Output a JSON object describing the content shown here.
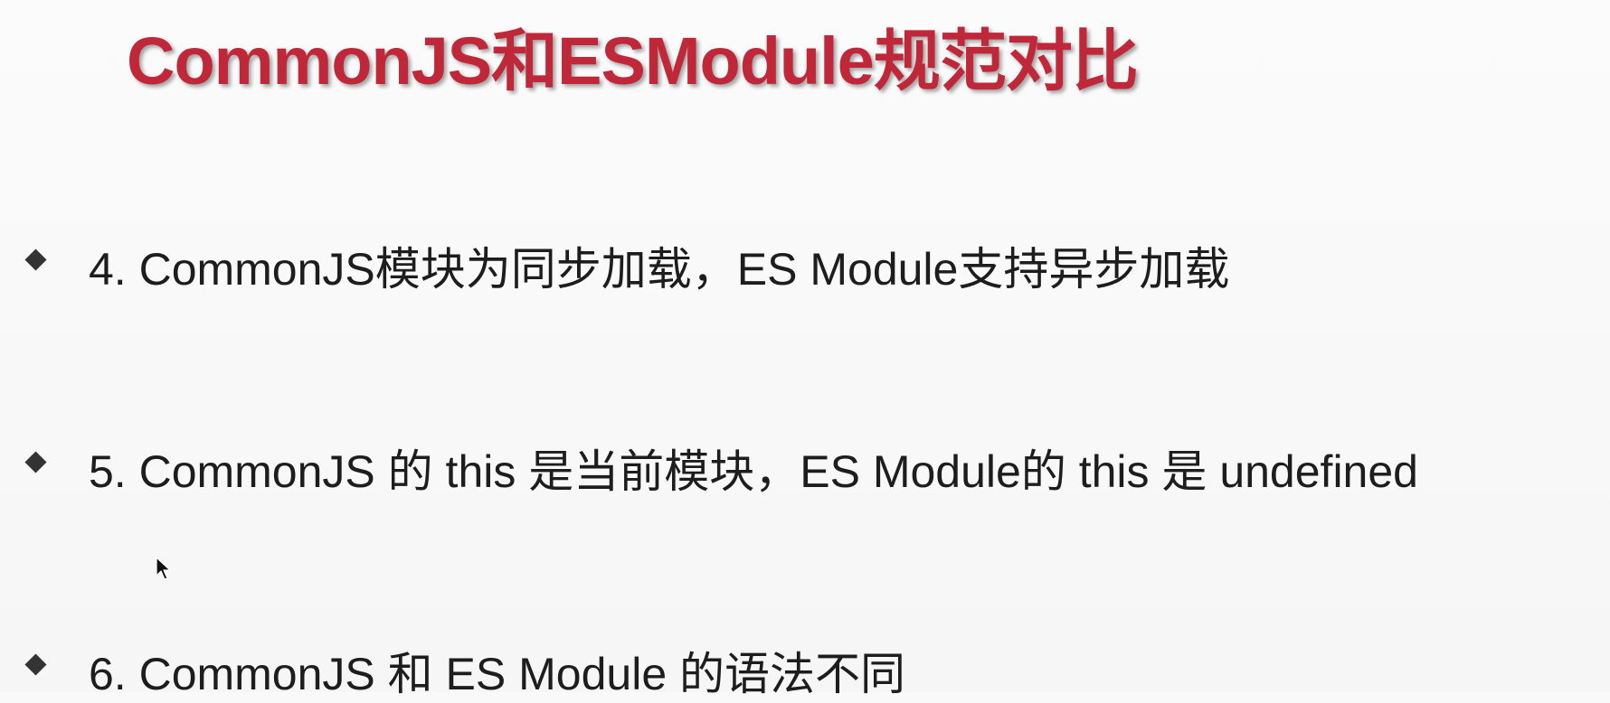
{
  "slide": {
    "title": "CommonJS和ESModule规范对比",
    "bullets": [
      "4. CommonJS模块为同步加载，ES Module支持异步加载",
      "5. CommonJS 的 this 是当前模块，ES Module的 this 是 undefined",
      "6. CommonJS 和 ES Module 的语法不同"
    ]
  },
  "icons": {
    "bullet": "diamond-bullet-icon",
    "cursor": "mouse-pointer-icon"
  },
  "colors": {
    "title": "#c0283a",
    "text": "#1d1d1d",
    "background": "#f8f9f8"
  }
}
